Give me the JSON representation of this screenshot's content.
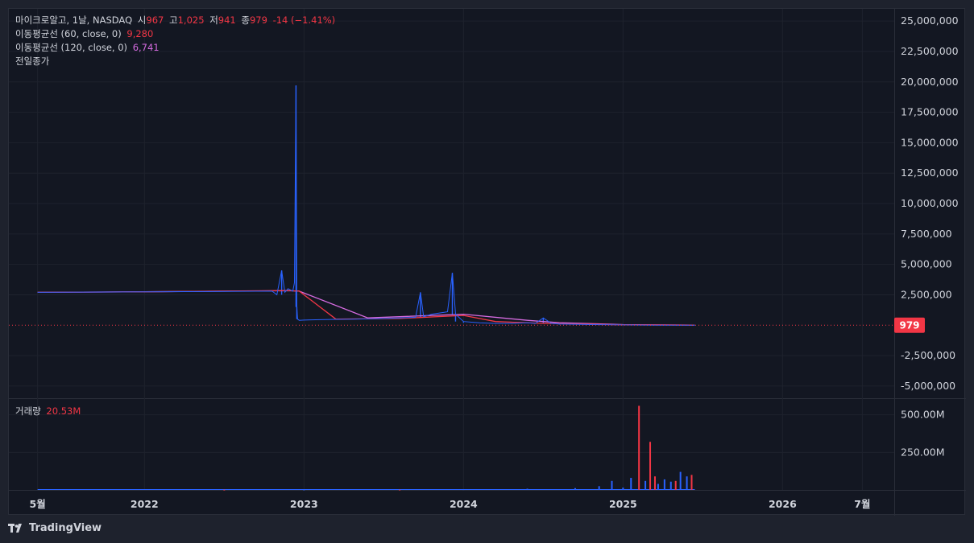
{
  "legend": {
    "symbol": "마이크로알고, 1날, NASDAQ",
    "open_label": "시",
    "open": "967",
    "high_label": "고",
    "high": "1,025",
    "low_label": "저",
    "low": "941",
    "close_label": "종",
    "close": "979",
    "change": "-14 (−1.41%)",
    "ma60_label": "이동평균선 (60, close, 0)",
    "ma60_value": "9,280",
    "ma120_label": "이동평균선 (120, close, 0)",
    "ma120_value": "6,741",
    "prev_close_label": "전일종가",
    "volume_label": "거래량",
    "volume_value": "20.53M"
  },
  "price_badge": "979",
  "branding": {
    "name": "TradingView"
  },
  "colors": {
    "up": "#2962ff",
    "down": "#f23645",
    "ma60": "#f23645",
    "ma120": "#d66be0",
    "price_line": "#f23645"
  },
  "chart_data": {
    "type": "line",
    "price_axis": {
      "ylim": [
        -6000000,
        26000000
      ],
      "ticks": [
        25000000,
        22500000,
        20000000,
        17500000,
        15000000,
        12500000,
        10000000,
        7500000,
        5000000,
        2500000,
        -2500000,
        -5000000
      ],
      "tick_labels": [
        "25,000,000",
        "22,500,000",
        "20,000,000",
        "17,500,000",
        "15,000,000",
        "12,500,000",
        "10,000,000",
        "7,500,000",
        "5,000,000",
        "2,500,000",
        "-2,500,000",
        "-5,000,000"
      ]
    },
    "volume_axis": {
      "ylim": [
        0,
        600000000
      ],
      "ticks": [
        500000000,
        250000000
      ],
      "tick_labels": [
        "500.00M",
        "250.00M"
      ]
    },
    "time_axis": {
      "range": [
        2021.15,
        2026.7
      ],
      "ticks": [
        2021.33,
        2022.0,
        2023.0,
        2024.0,
        2025.0,
        2026.0,
        2026.5
      ],
      "tick_labels": [
        "5월",
        "2022",
        "2023",
        "2024",
        "2025",
        "2026",
        "7월"
      ]
    },
    "last_price": 979,
    "series": [
      {
        "kind": "price",
        "x": [
          2021.33,
          2021.6,
          2022.0,
          2022.4,
          2022.8,
          2022.83,
          2022.86,
          2022.88,
          2022.9,
          2022.93,
          2022.94,
          2022.95,
          2022.955,
          2022.96,
          2022.97,
          2023.0,
          2023.1,
          2023.2,
          2023.3,
          2023.4,
          2023.5,
          2023.6,
          2023.7,
          2023.73,
          2023.75,
          2023.8,
          2023.85,
          2023.9,
          2023.93,
          2023.95,
          2024.0,
          2024.1,
          2024.2,
          2024.3,
          2024.4,
          2024.45,
          2024.5,
          2024.55,
          2024.6,
          2024.8,
          2025.0,
          2025.2,
          2025.3,
          2025.45
        ],
        "y": [
          2700000,
          2720000,
          2750000,
          2770000,
          2800000,
          2500000,
          4500000,
          2700000,
          3000000,
          2800000,
          3500000,
          19700000,
          1500000,
          500000,
          400000,
          420000,
          450000,
          480000,
          500000,
          520000,
          550000,
          600000,
          650000,
          2700000,
          700000,
          900000,
          1000000,
          1100000,
          4300000,
          900000,
          300000,
          200000,
          150000,
          150000,
          200000,
          150000,
          600000,
          150000,
          100000,
          50000,
          20000,
          5000,
          2000,
          979
        ]
      },
      {
        "name": "이동평균선 (60, close, 0)",
        "kind": "ma60",
        "x": [
          2021.33,
          2022.0,
          2022.9,
          2022.97,
          2023.2,
          2023.6,
          2024.0,
          2024.2,
          2024.5,
          2025.0,
          2025.45
        ],
        "y": [
          2700000,
          2750000,
          2850000,
          2800000,
          500000,
          550000,
          800000,
          300000,
          150000,
          30000,
          9280
        ]
      },
      {
        "name": "이동평균선 (120, close, 0)",
        "kind": "ma120",
        "x": [
          2021.33,
          2022.0,
          2022.9,
          2022.97,
          2023.4,
          2024.0,
          2024.4,
          2024.6,
          2025.0,
          2025.45
        ],
        "y": [
          2700000,
          2750000,
          2830000,
          2800000,
          600000,
          900000,
          400000,
          200000,
          50000,
          6741
        ]
      },
      {
        "kind": "volume",
        "x": [
          2022.5,
          2023.0,
          2023.6,
          2024.0,
          2024.4,
          2024.7,
          2024.85,
          2024.93,
          2025.0,
          2025.05,
          2025.1,
          2025.14,
          2025.17,
          2025.2,
          2025.22,
          2025.26,
          2025.3,
          2025.33,
          2025.36,
          2025.4,
          2025.43
        ],
        "y": [
          2000000,
          3000000,
          2000000,
          5000000,
          8000000,
          12000000,
          25000000,
          60000000,
          15000000,
          80000000,
          560000000,
          60000000,
          320000000,
          90000000,
          40000000,
          70000000,
          55000000,
          60000000,
          120000000,
          90000000,
          100000000
        ],
        "up": [
          false,
          true,
          false,
          true,
          true,
          true,
          true,
          true,
          true,
          true,
          false,
          true,
          false,
          false,
          true,
          true,
          true,
          false,
          true,
          true,
          false
        ]
      }
    ]
  }
}
